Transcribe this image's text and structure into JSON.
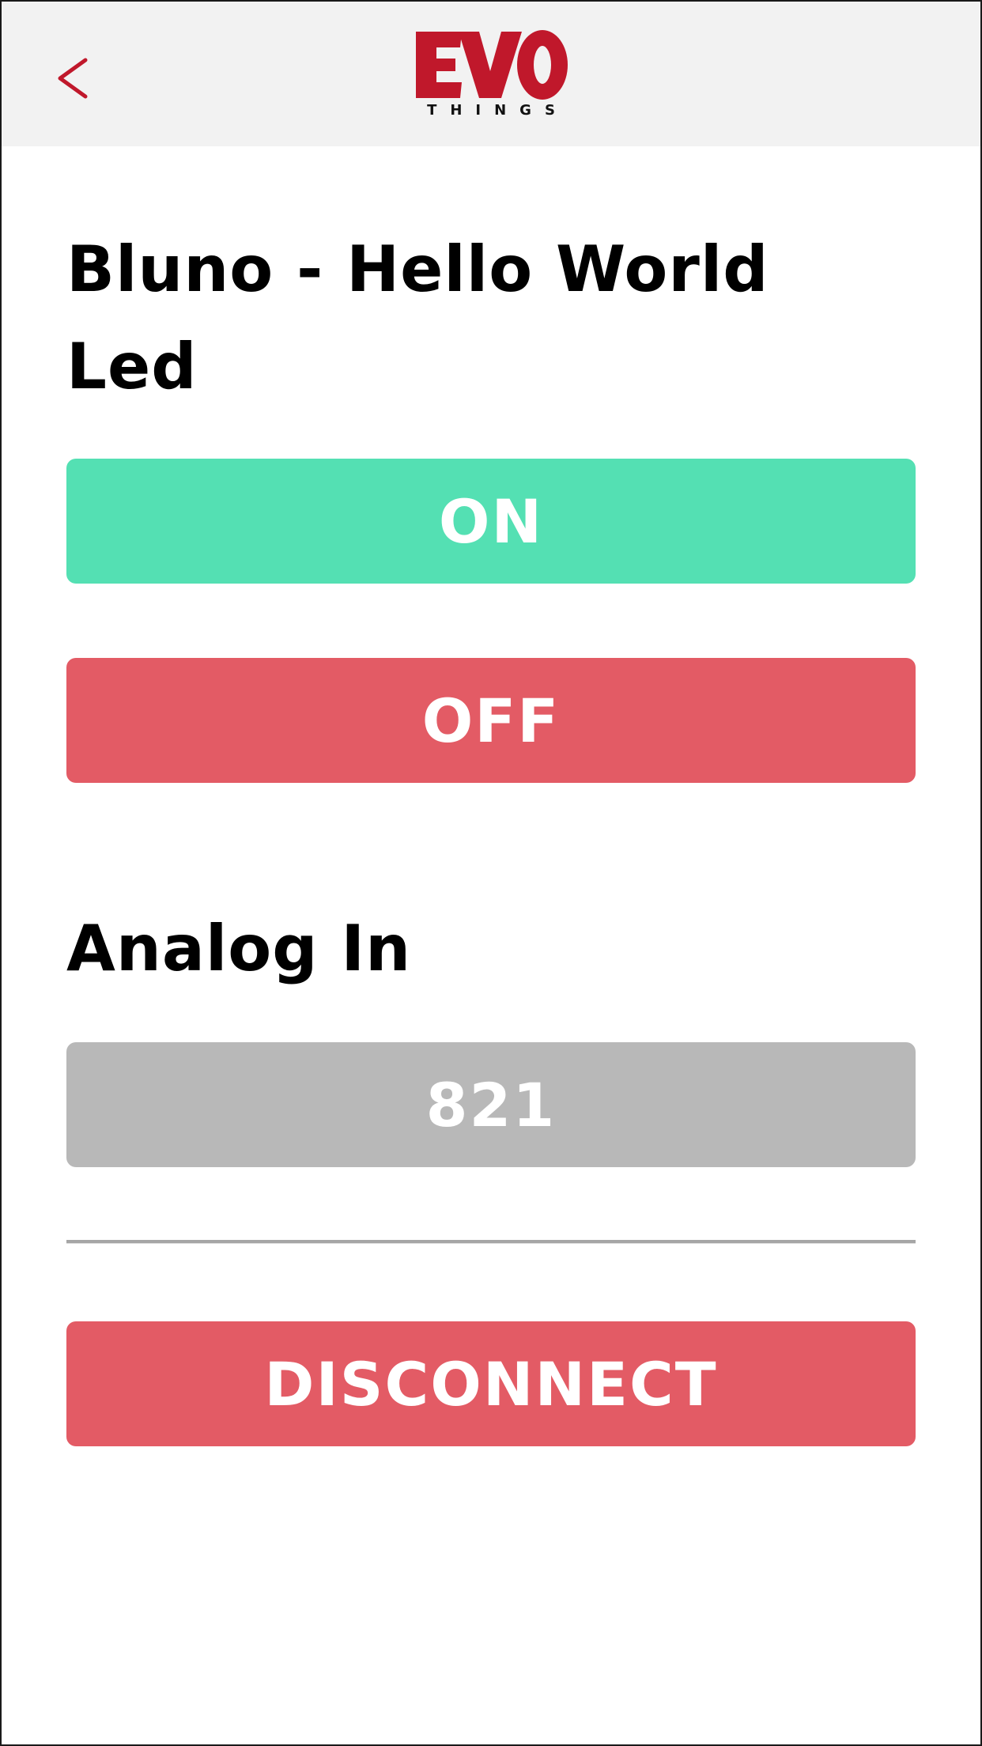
{
  "header": {
    "back_label": "<",
    "back_icon": "chevron-left-icon",
    "logo": {
      "main": "EVO",
      "sub": "THINGS",
      "color": "#c0182b"
    },
    "background": "#f2f2f2"
  },
  "main": {
    "title": "Bluno - Hello World",
    "led": {
      "heading": "Led",
      "on_label": "ON",
      "off_label": "OFF"
    },
    "analog": {
      "heading": "Analog In",
      "value": "821"
    },
    "disconnect_label": "DISCONNECT"
  },
  "colors": {
    "on": "#54e0b3",
    "off": "#e35b65",
    "value_box": "#b8b8b8",
    "accent": "#c0182b"
  }
}
